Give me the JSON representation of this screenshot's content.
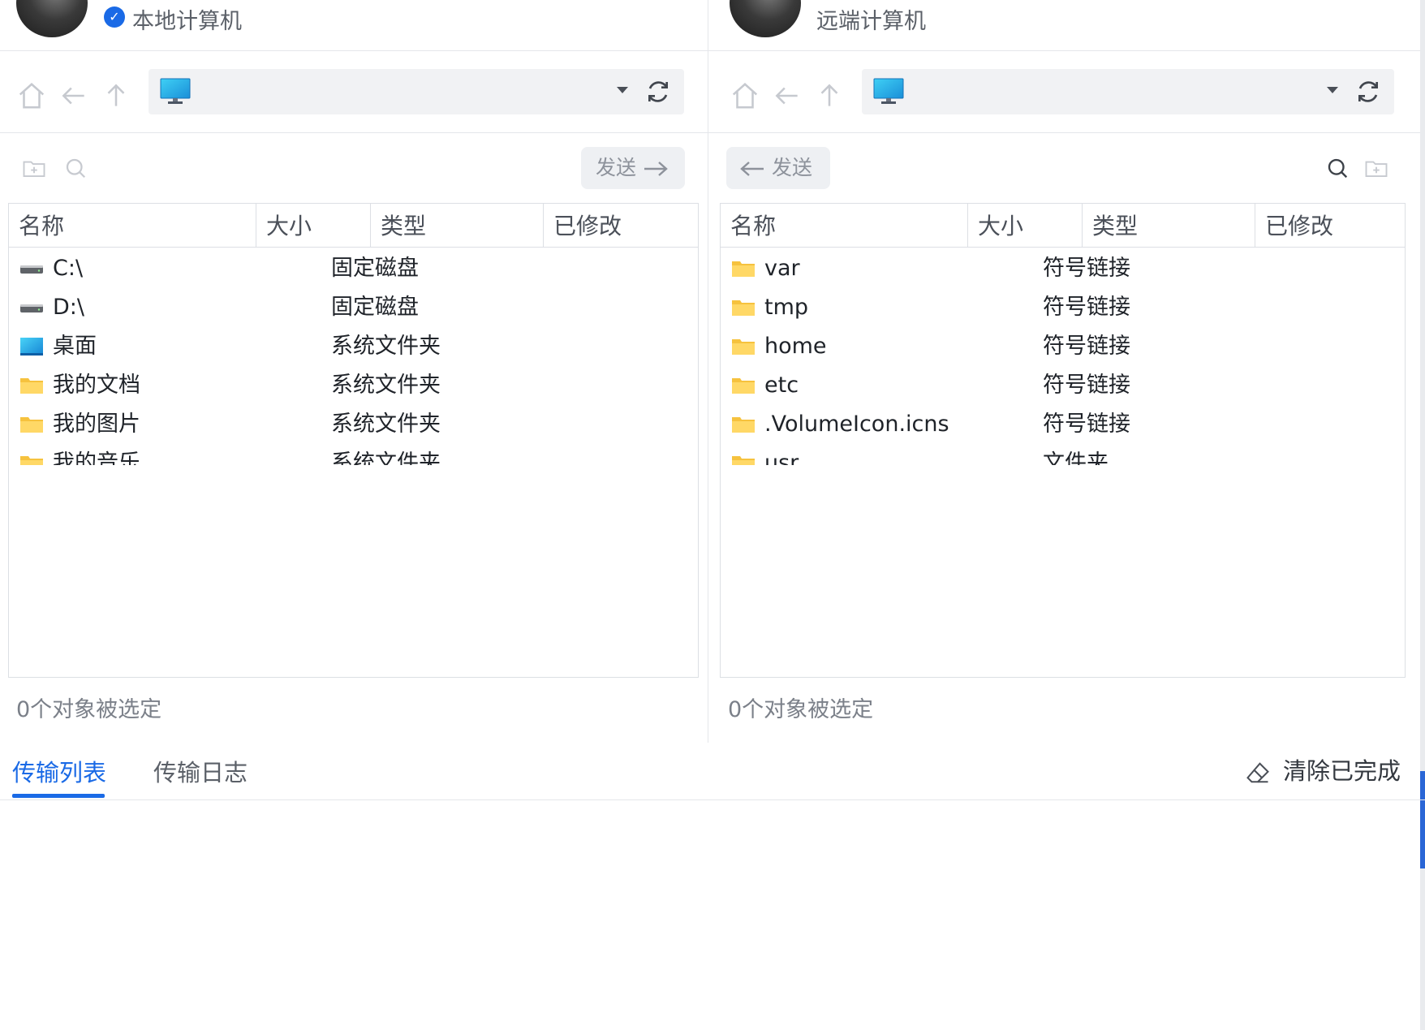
{
  "local": {
    "title": "本地计算机",
    "send_label": "发送",
    "columns": [
      "名称",
      "大小",
      "类型",
      "已修改"
    ],
    "rows": [
      {
        "icon": "drive-icon",
        "name": "C:\\",
        "type": "固定磁盘"
      },
      {
        "icon": "drive-icon",
        "name": "D:\\",
        "type": "固定磁盘"
      },
      {
        "icon": "desktop-folder-icon",
        "name": "桌面",
        "type": "系统文件夹"
      },
      {
        "icon": "folder-icon",
        "name": "我的文档",
        "type": "系统文件夹"
      },
      {
        "icon": "folder-icon",
        "name": "我的图片",
        "type": "系统文件夹"
      },
      {
        "icon": "folder-icon",
        "name": "我的音乐",
        "type": "系统文件夹"
      }
    ],
    "status": "0个对象被选定"
  },
  "remote": {
    "title": "远端计算机",
    "send_label": "发送",
    "columns": [
      "名称",
      "大小",
      "类型",
      "已修改"
    ],
    "rows": [
      {
        "icon": "folder-icon",
        "name": "var",
        "type": "符号链接"
      },
      {
        "icon": "folder-icon",
        "name": "tmp",
        "type": "符号链接"
      },
      {
        "icon": "folder-icon",
        "name": "home",
        "type": "符号链接"
      },
      {
        "icon": "folder-icon",
        "name": "etc",
        "type": "符号链接"
      },
      {
        "icon": "folder-icon",
        "name": ".VolumeIcon.icns",
        "type": "符号链接"
      },
      {
        "icon": "folder-icon",
        "name": "usr",
        "type": "文件夹"
      }
    ],
    "status": "0个对象被选定"
  },
  "tabs": [
    {
      "label": "传输列表",
      "active": true
    },
    {
      "label": "传输日志",
      "active": false
    }
  ],
  "clear_completed_label": "清除已完成",
  "colors": {
    "accent": "#1a6ae6",
    "folder": "#f6c23e",
    "border": "#dcdfe4"
  }
}
